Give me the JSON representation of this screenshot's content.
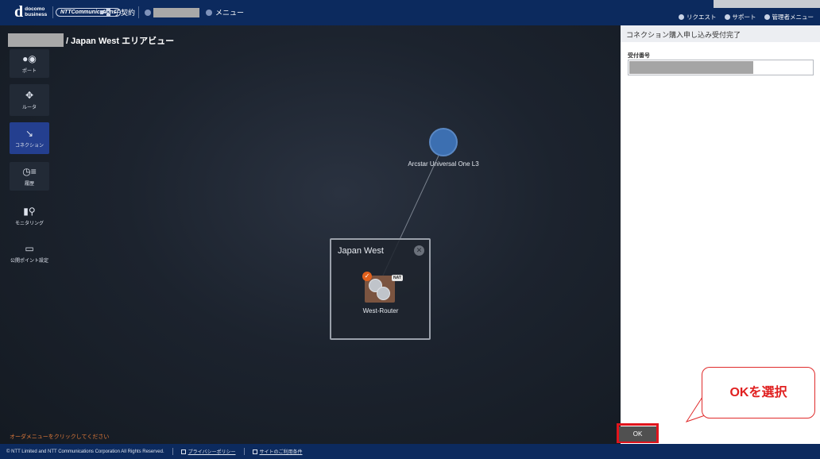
{
  "header": {
    "brand_line1": "docomo",
    "brand_line2": "business",
    "brand_letter": "d",
    "partner_logo": "NTTCommunications",
    "contract_label": "子契約",
    "menu_label": "メニュー",
    "right_links": [
      "リクエスト",
      "サポート",
      "管理者メニュー"
    ]
  },
  "breadcrumb": {
    "text": "/ Japan West エリアビュー"
  },
  "sidebar": {
    "items": [
      {
        "label": "ポート",
        "icon": "port-icon"
      },
      {
        "label": "ルータ",
        "icon": "router-icon"
      },
      {
        "label": "コネクション",
        "icon": "connection-icon",
        "active": true
      },
      {
        "label": "履歴",
        "icon": "history-icon"
      },
      {
        "label": "モニタリング",
        "icon": "monitoring-icon"
      },
      {
        "label": "公開ポイント設定",
        "icon": "monitor-icon"
      }
    ]
  },
  "canvas": {
    "network_label": "Arcstar Universal One L3",
    "region_title": "Japan West",
    "router_label": "West-Router",
    "nat_badge": "NAT",
    "order_message": "オーダメニューをクリックしてください"
  },
  "panel": {
    "title": "コネクション購入申し込み受付完了",
    "field_label": "受付番号",
    "ok_label": "OK"
  },
  "callout": {
    "text": "OKを選択"
  },
  "footer": {
    "copyright": "© NTT Limited and NTT Communications Corporation All Rights Reserved.",
    "links": [
      "プライバシーポリシー",
      "サイトのご利用条件"
    ]
  },
  "colors": {
    "header_bg": "#0c2a5e",
    "active_side": "#243f8f",
    "router_bg": "#7b5440",
    "highlight": "#e0141c",
    "order_text": "#e07a3a"
  }
}
